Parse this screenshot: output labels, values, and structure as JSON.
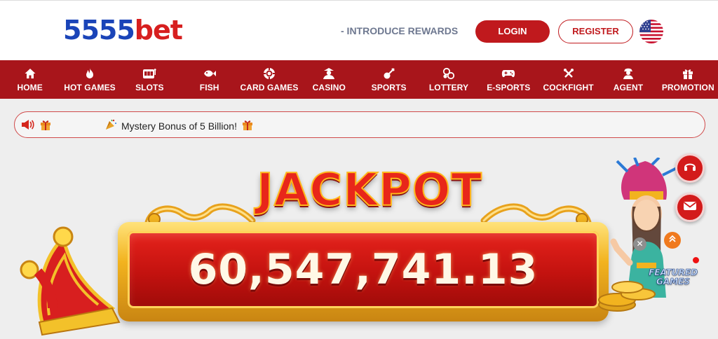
{
  "header": {
    "logo_number": "5555",
    "logo_text": "bet",
    "introduce_rewards": "- INTRODUCE REWARDS",
    "login_label": "LOGIN",
    "register_label": "REGISTER",
    "language_flag_icon": "us-flag-icon"
  },
  "nav": {
    "items": [
      {
        "label": "HOME",
        "icon": "home-icon"
      },
      {
        "label": "HOT GAMES",
        "icon": "flame-icon"
      },
      {
        "label": "SLOTS",
        "icon": "slot-machine-icon"
      },
      {
        "label": "FISH",
        "icon": "fish-icon"
      },
      {
        "label": "CARD GAMES",
        "icon": "poker-chip-icon"
      },
      {
        "label": "CASINO",
        "icon": "dealer-icon"
      },
      {
        "label": "SPORTS",
        "icon": "sports-icon"
      },
      {
        "label": "LOTTERY",
        "icon": "lottery-balls-icon"
      },
      {
        "label": "E-SPORTS",
        "icon": "gamepad-icon"
      },
      {
        "label": "COCKFIGHT",
        "icon": "rooster-icon"
      },
      {
        "label": "AGENT",
        "icon": "agent-icon"
      },
      {
        "label": "PROMOTION",
        "icon": "gift-icon"
      }
    ]
  },
  "marquee": {
    "message": "Mystery Bonus of 5 Billion!"
  },
  "jackpot": {
    "title": "JACKPOT",
    "value": "60,547,741.13"
  },
  "widgets": {
    "close_symbol": "✕",
    "featured_line1": "FEATURED",
    "featured_line2": "GAMES"
  },
  "colors": {
    "brand_red": "#a8151b",
    "logo_blue": "#1a44b8",
    "logo_red": "#d71f1f",
    "gold": "#f2b31f"
  }
}
